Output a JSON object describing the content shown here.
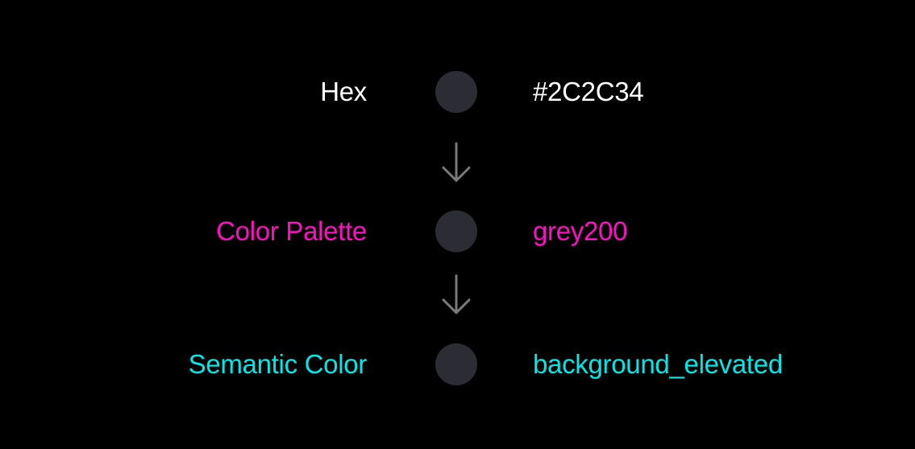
{
  "rows": [
    {
      "label": "Hex",
      "value": "#2C2C34",
      "label_color": "#FFFFFF",
      "value_color": "#FFFFFF"
    },
    {
      "label": "Color Palette",
      "value": "grey200",
      "label_color": "#FF0FC3",
      "value_color": "#FF0FC3"
    },
    {
      "label": "Semantic Color",
      "value": "background_elevated",
      "label_color": "#00E8E8",
      "value_color": "#00E8E8"
    }
  ],
  "swatch_color": "#2C2C34",
  "arrow_color": "#7A7A7A",
  "arrow_icon": "arrow-down-icon"
}
